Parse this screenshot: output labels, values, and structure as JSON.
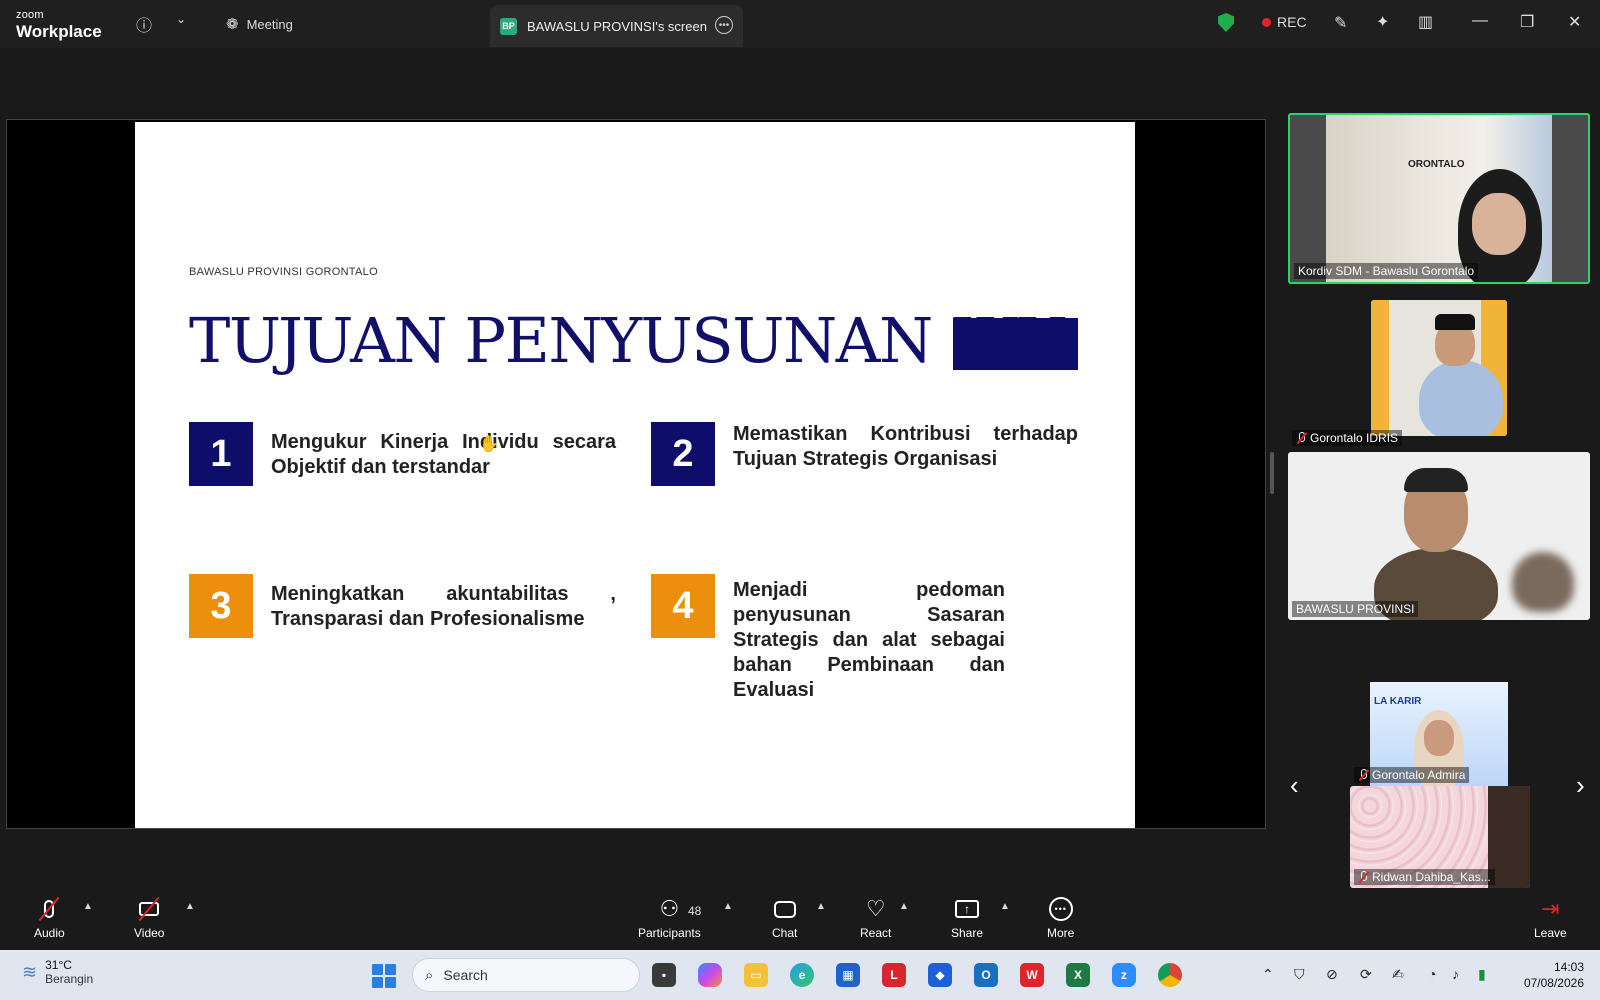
{
  "titlebar": {
    "logo_top": "zoom",
    "logo_bottom": "Workplace",
    "meeting_label": "Meeting",
    "screen_tab_badge": "BP",
    "screen_tab_label": "BAWASLU PROVINSI's screen",
    "rec_label": "REC",
    "colors": {
      "shield": "#1fae4b",
      "rec": "#e0242c",
      "tab_badge": "#2fa87c"
    }
  },
  "slide": {
    "org": "BAWASLU PROVINSI GORONTALO",
    "title": "TUJUAN PENYUSUNAN IKU",
    "items": [
      {
        "num": "1",
        "text": "Mengukur Kinerja Individu secara Objektif dan terstandar"
      },
      {
        "num": "2",
        "text": "Memastikan Kontribusi terhadap Tujuan Strategis Organisasi"
      },
      {
        "num": "3",
        "text": "Meningkatkan akuntabilitas , Transparasi dan Profesionalisme"
      },
      {
        "num": "4",
        "text": "Menjadi pedoman penyusunan Sasaran Strategis dan alat sebagai bahan Pembinaan dan Evaluasi"
      }
    ],
    "colors": {
      "navy": "#0e0e6a",
      "orange": "#ec8f0c"
    }
  },
  "participants": [
    {
      "name": "Kordiv SDM - Bawaslu Gorontalo",
      "muted": false,
      "active_speaker": true,
      "bg_text": "ORONTALO"
    },
    {
      "name": "Gorontalo IDRIS",
      "muted": true
    },
    {
      "name": "BAWASLU PROVINSI",
      "muted": false
    },
    {
      "name": "Gorontalo Admira",
      "muted": true,
      "bg_text": "LA KARIR"
    },
    {
      "name": "Ridwan Dahiba_Kas...",
      "muted": true
    }
  ],
  "toolbar": {
    "audio": "Audio",
    "video": "Video",
    "participants": "Participants",
    "participants_count": "48",
    "chat": "Chat",
    "react": "React",
    "share": "Share",
    "more": "More",
    "leave": "Leave"
  },
  "taskbar": {
    "temp": "31°C",
    "weather": "Berangin",
    "search_placeholder": "Search",
    "time": "14:03",
    "date": "07/08/2026"
  }
}
